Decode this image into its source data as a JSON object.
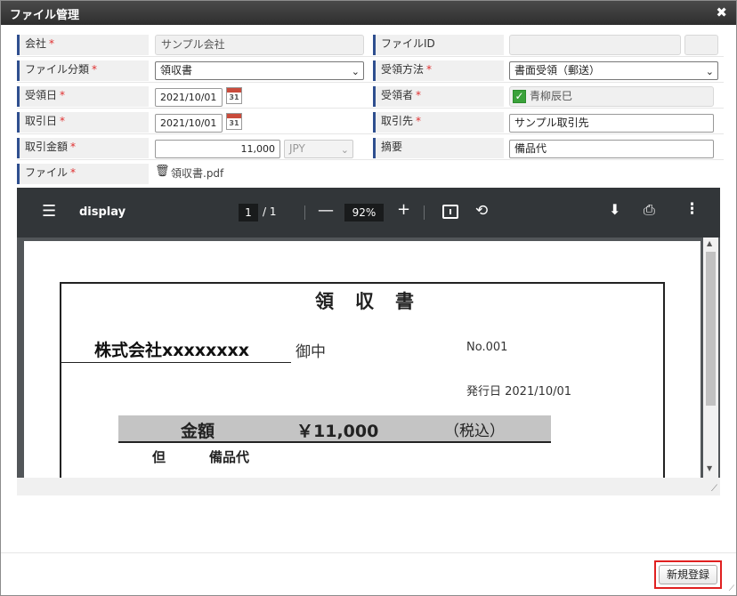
{
  "dialog": {
    "title": "ファイル管理",
    "close_glyph": "✖"
  },
  "form": {
    "required_mark": "*",
    "company": {
      "label": "会社",
      "value": "サンプル会社"
    },
    "file_id": {
      "label": "ファイルID",
      "value": ""
    },
    "file_type": {
      "label": "ファイル分類",
      "value": "領収書"
    },
    "receive_method": {
      "label": "受領方法",
      "value": "書面受領（郵送）"
    },
    "receive_date": {
      "label": "受領日",
      "value": "2021/10/01"
    },
    "receiver": {
      "label": "受領者",
      "value": "青柳辰巳"
    },
    "deal_date": {
      "label": "取引日",
      "value": "2021/10/01"
    },
    "partner": {
      "label": "取引先",
      "value": "サンプル取引先"
    },
    "amount": {
      "label": "取引金額",
      "value": "11,000",
      "currency": "JPY"
    },
    "summary": {
      "label": "摘要",
      "value": "備品代"
    },
    "file": {
      "label": "ファイル",
      "name": "領収書.pdf"
    },
    "calendar_day": "31"
  },
  "viewer": {
    "doc_name": "display",
    "page_current": "1",
    "page_total": "/  1",
    "zoom": "92%",
    "minus": "—",
    "plus": "+"
  },
  "receipt": {
    "title": "領収書",
    "company": "株式会社xxxxxxxx",
    "honorific": "御中",
    "number": "No.001",
    "issue_date": "発行日 2021/10/01",
    "amount_label": "金額",
    "amount": "￥11,000",
    "tax": "（税込）",
    "tada": "但",
    "item": "備品代"
  },
  "footer": {
    "submit_label": "新規登録"
  },
  "colors": {
    "required": "#e03030",
    "titlebar": "#3a3a3a",
    "label_bar": "#2f4f8f",
    "highlight": "#e02020"
  }
}
